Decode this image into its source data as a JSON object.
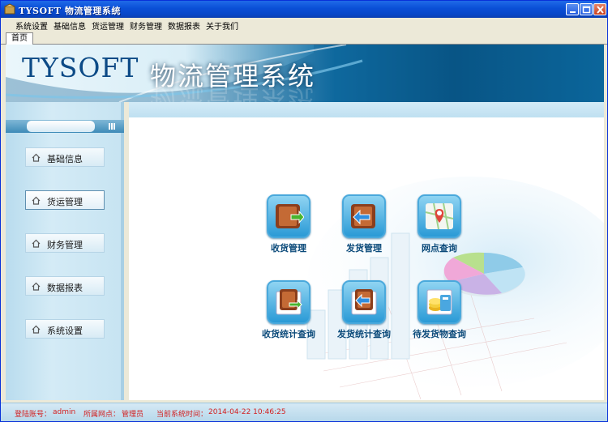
{
  "window": {
    "title": "TYSOFT  物流管理系统"
  },
  "menu": [
    "系统设置",
    "基础信息",
    "货运管理",
    "财务管理",
    "数据报表",
    "关于我们"
  ],
  "tabs": [
    "首页"
  ],
  "banner": {
    "logo": "TYSOFT",
    "title": "物流管理系统"
  },
  "sidebar": {
    "items": [
      {
        "label": "基础信息",
        "active": false
      },
      {
        "label": "货运管理",
        "active": true
      },
      {
        "label": "财务管理",
        "active": false
      },
      {
        "label": "数据报表",
        "active": false
      },
      {
        "label": "系统设置",
        "active": false
      }
    ]
  },
  "functions": [
    {
      "label": "收货管理",
      "icon": "receive-goods-icon"
    },
    {
      "label": "发货管理",
      "icon": "ship-goods-icon"
    },
    {
      "label": "网点查询",
      "icon": "map-pin-icon"
    },
    {
      "label": "收货统计查询",
      "icon": "receive-stats-icon"
    },
    {
      "label": "发货统计查询",
      "icon": "ship-stats-icon"
    },
    {
      "label": "待发货物查询",
      "icon": "pending-goods-icon"
    }
  ],
  "status": {
    "account_label": "登陆账号：",
    "account_value": "admin",
    "branch_label": "所属网点：",
    "branch_value": "管理员",
    "time_label": "当前系统时间：",
    "time_value": "2014-04-22 10:46:25"
  },
  "colors": {
    "title_bar": "#0a4fd6",
    "status_text": "#d21f1f",
    "label_text": "#0b4a7a"
  }
}
